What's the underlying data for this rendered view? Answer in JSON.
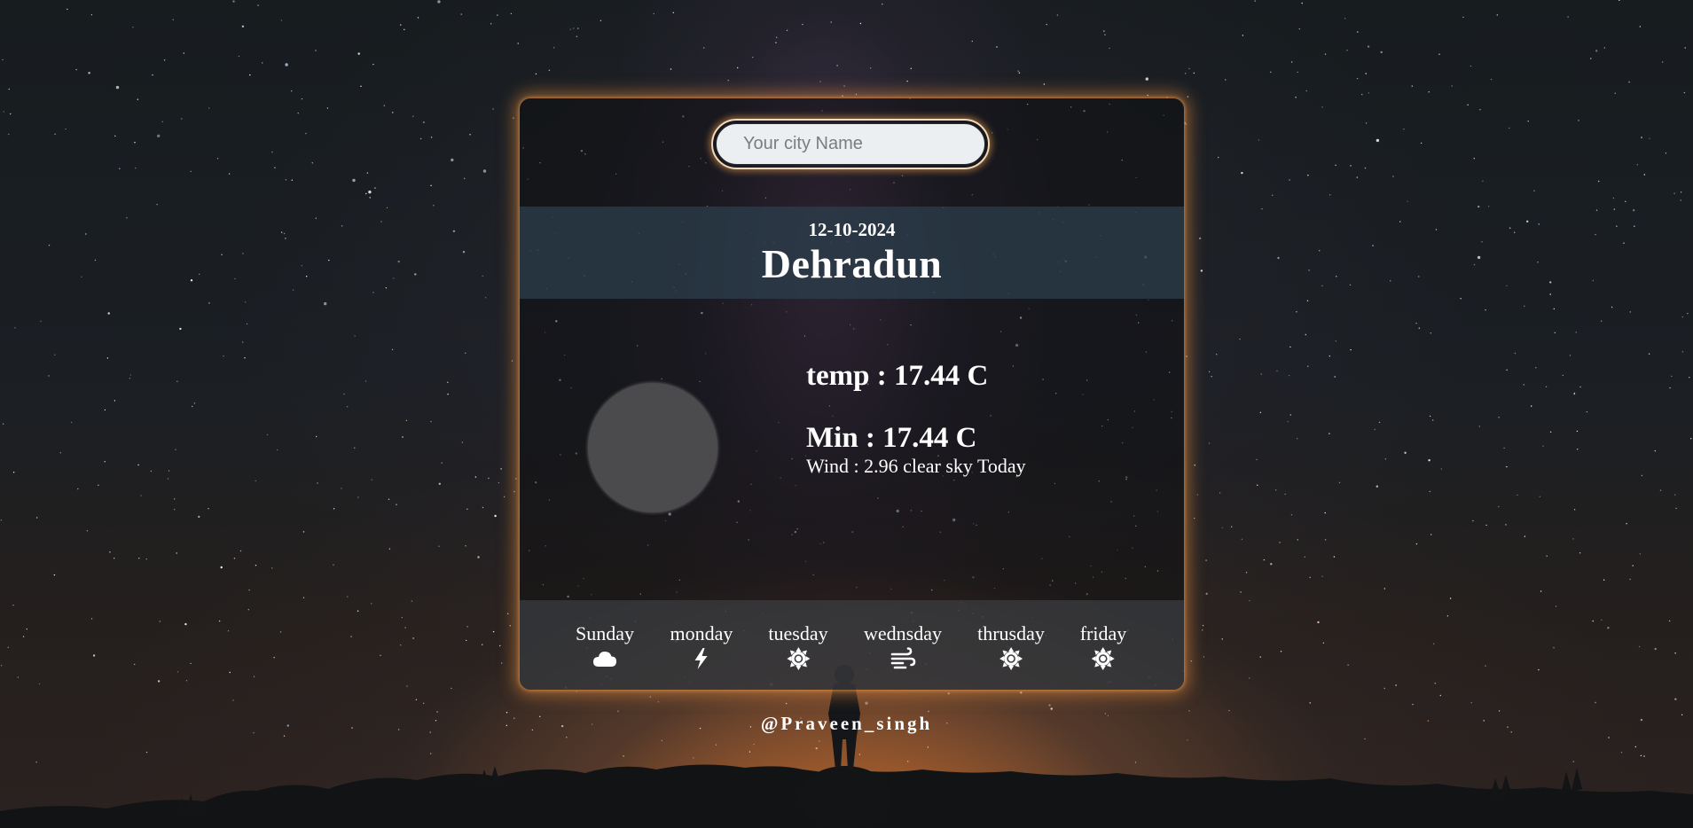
{
  "search": {
    "placeholder": "Your city Name",
    "value": ""
  },
  "header": {
    "date": "12-10-2024",
    "city": "Dehradun"
  },
  "current": {
    "temp": "temp : 17.44 C",
    "min": "Min : 17.44 C",
    "wind": "Wind : 2.96 clear sky Today"
  },
  "forecast": [
    {
      "day": "Sunday",
      "icon": "cloud-icon"
    },
    {
      "day": "monday",
      "icon": "lightning-icon"
    },
    {
      "day": "tuesday",
      "icon": "sun-icon"
    },
    {
      "day": "wednsday",
      "icon": "wind-icon"
    },
    {
      "day": "thrusday",
      "icon": "sun-icon"
    },
    {
      "day": "friday",
      "icon": "sun-icon"
    }
  ],
  "footer": {
    "credit": "@Praveen_singh"
  },
  "colors": {
    "glow": "#e68c3c",
    "band": "#2d404e",
    "icon_circle": "#4b4b4d"
  }
}
